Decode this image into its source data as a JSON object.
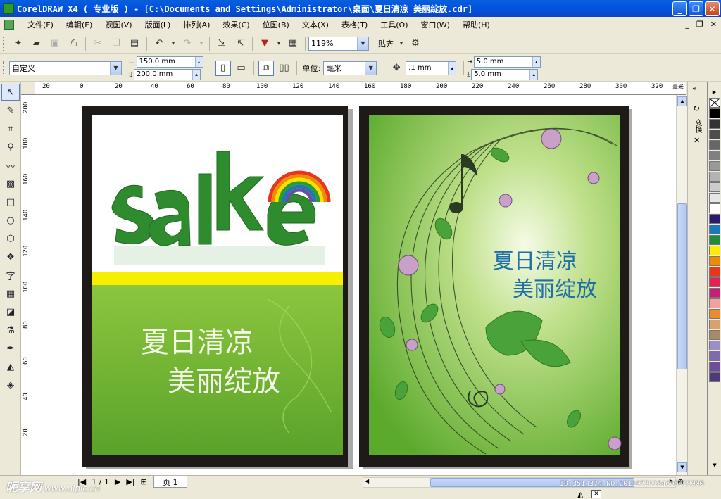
{
  "window": {
    "title": "CorelDRAW X4 ( 专业版 ) - [C:\\Documents and Settings\\Administrator\\桌面\\夏日清凉 美丽绽放.cdr]",
    "minimize": "_",
    "maximize": "❐",
    "close": "✕"
  },
  "menu": {
    "items": [
      "文件(F)",
      "编辑(E)",
      "视图(V)",
      "版面(L)",
      "排列(A)",
      "效果(C)",
      "位图(B)",
      "文本(X)",
      "表格(T)",
      "工具(O)",
      "窗口(W)",
      "帮助(H)"
    ],
    "mdi": [
      "_",
      "❐",
      "✕"
    ]
  },
  "toolbar": {
    "zoom": "119%",
    "snap_label": "贴齐"
  },
  "property_bar": {
    "page_preset": "自定义",
    "width": "150.0 mm",
    "height": "200.0 mm",
    "units_label": "单位:",
    "units": "毫米",
    "nudge": ".1 mm",
    "dup_x": "5.0 mm",
    "dup_y": "5.0 mm"
  },
  "ruler": {
    "top": [
      "20",
      "0",
      "20",
      "40",
      "60",
      "80",
      "100",
      "120",
      "140",
      "160",
      "180",
      "200",
      "220",
      "240",
      "260",
      "280",
      "300",
      "320"
    ],
    "top_unit": "毫米",
    "left": [
      "200",
      "180",
      "160",
      "140",
      "120",
      "100",
      "80",
      "60",
      "40",
      "20"
    ]
  },
  "docker": {
    "tab_label": "变换"
  },
  "palette": {
    "colors": [
      "#000000",
      "#333333",
      "#4D4D4D",
      "#666666",
      "#808080",
      "#999999",
      "#B3B3B3",
      "#CCCCCC",
      "#E6E6E6",
      "#FFFFFF",
      "#2D1A6E",
      "#1A7AB8",
      "#1E8C3A",
      "#FFEE00",
      "#F08A00",
      "#E8361E",
      "#E8205A",
      "#C81E78",
      "#F3A0A0",
      "#E98C2C",
      "#D9A070",
      "#A88A68",
      "#9A8FC8",
      "#7E6AB0",
      "#6E4E9A",
      "#4C3A7A"
    ]
  },
  "poster_left": {
    "headline_line1": "夏日清凉",
    "headline_line2": "美丽绽放"
  },
  "poster_right": {
    "headline_line1": "夏日清凉",
    "headline_line2": "美丽绽放"
  },
  "status": {
    "page_count": "1 / 1",
    "page_tab": "页 1",
    "watermark": "昵享网",
    "watermark_url": "www.nipic.cn",
    "image_id": "ID:3514374 NO:20110720184606119000"
  }
}
